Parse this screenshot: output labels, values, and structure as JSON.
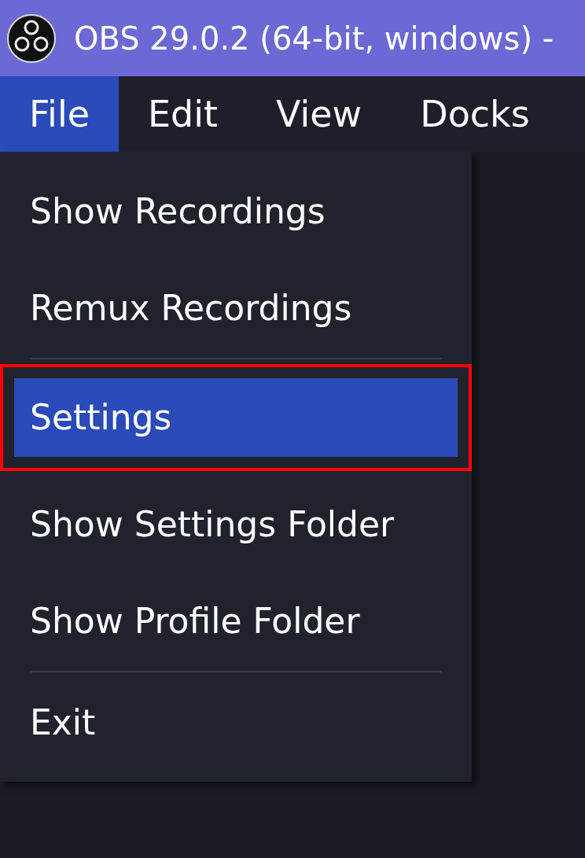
{
  "window": {
    "title": "OBS 29.0.2 (64-bit, windows) -"
  },
  "menu_bar": [
    {
      "label": "File",
      "selected": true
    },
    {
      "label": "Edit",
      "selected": false
    },
    {
      "label": "View",
      "selected": false
    },
    {
      "label": "Docks",
      "selected": false
    }
  ],
  "file_menu": [
    {
      "kind": "item",
      "label": "Show Recordings",
      "selected": false,
      "outlined": false
    },
    {
      "kind": "item",
      "label": "Remux Recordings",
      "selected": false,
      "outlined": false
    },
    {
      "kind": "separator"
    },
    {
      "kind": "item",
      "label": "Settings",
      "selected": true,
      "outlined": true
    },
    {
      "kind": "item",
      "label": "Show Settings Folder",
      "selected": false,
      "outlined": false
    },
    {
      "kind": "item",
      "label": "Show Profile Folder",
      "selected": false,
      "outlined": false
    },
    {
      "kind": "separator"
    },
    {
      "kind": "item",
      "label": "Exit",
      "selected": false,
      "outlined": false
    }
  ]
}
